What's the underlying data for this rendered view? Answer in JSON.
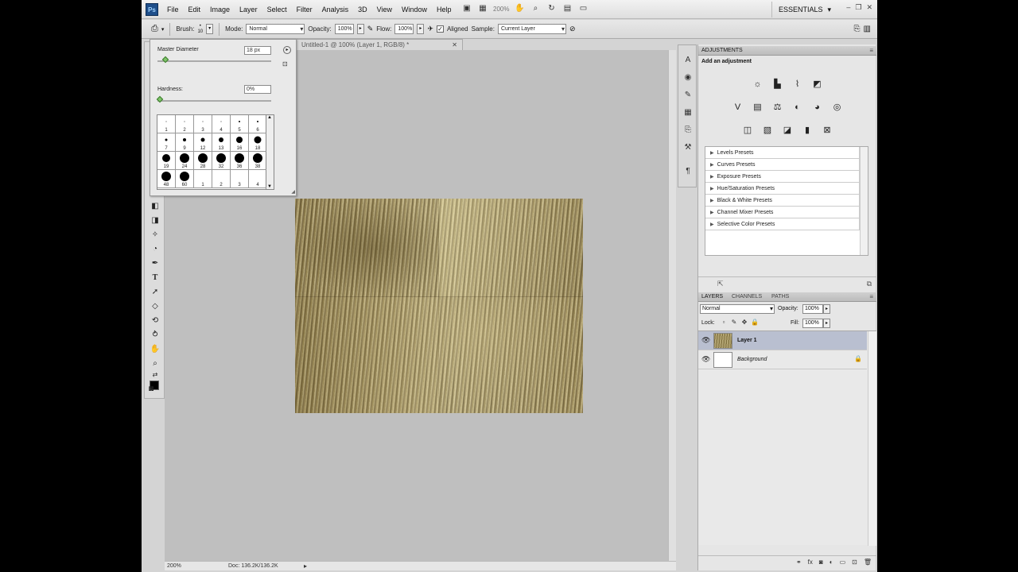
{
  "menubar": {
    "logo": "Ps",
    "items": [
      "File",
      "Edit",
      "Image",
      "Layer",
      "Select",
      "Filter",
      "Analysis",
      "3D",
      "View",
      "Window",
      "Help"
    ],
    "zoom": "200%",
    "workspace": "ESSENTIALS"
  },
  "options": {
    "brush_label": "Brush:",
    "brush_size": "10",
    "mode_label": "Mode:",
    "mode_value": "Normal",
    "opacity_label": "Opacity:",
    "opacity_value": "100%",
    "flow_label": "Flow:",
    "flow_value": "100%",
    "aligned_label": "Aligned",
    "sample_label": "Sample:",
    "sample_value": "Current Layer"
  },
  "brush_popup": {
    "master_diameter_label": "Master Diameter",
    "master_diameter_value": "18 px",
    "hardness_label": "Hardness:",
    "hardness_value": "0%",
    "presets": [
      {
        "label": "1",
        "dot": 1
      },
      {
        "label": "2",
        "dot": 1
      },
      {
        "label": "3",
        "dot": 1
      },
      {
        "label": "4",
        "dot": 1
      },
      {
        "label": "5",
        "dot": 2
      },
      {
        "label": "6",
        "dot": 2
      },
      {
        "label": "7",
        "dot": 3
      },
      {
        "label": "9",
        "dot": 4
      },
      {
        "label": "12",
        "dot": 5
      },
      {
        "label": "13",
        "dot": 6
      },
      {
        "label": "16",
        "dot": 8
      },
      {
        "label": "18",
        "dot": 9
      },
      {
        "label": "19",
        "dot": 10
      },
      {
        "label": "24",
        "dot": 12
      },
      {
        "label": "28",
        "dot": 12
      },
      {
        "label": "32",
        "dot": 12
      },
      {
        "label": "36",
        "dot": 12
      },
      {
        "label": "38",
        "dot": 12
      },
      {
        "label": "48",
        "dot": 12
      },
      {
        "label": "60",
        "dot": 12
      },
      {
        "label": "1",
        "dot": 0
      },
      {
        "label": "2",
        "dot": 0
      },
      {
        "label": "3",
        "dot": 0
      },
      {
        "label": "4",
        "dot": 0
      }
    ]
  },
  "document": {
    "tab_title": "Untitled-1 @ 100% (Layer 1, RGB/8) *",
    "status_zoom": "200%",
    "status_doc": "Doc: 136.2K/136.2K"
  },
  "adjustments": {
    "tab": "ADJUSTMENTS",
    "subtitle": "Add an adjustment",
    "presets": [
      "Levels Presets",
      "Curves Presets",
      "Exposure Presets",
      "Hue/Saturation Presets",
      "Black & White Presets",
      "Channel Mixer Presets",
      "Selective Color Presets"
    ]
  },
  "layers_panel": {
    "tabs": [
      "LAYERS",
      "CHANNELS",
      "PATHS"
    ],
    "blend_mode": "Normal",
    "opacity_label": "Opacity:",
    "opacity_value": "100%",
    "lock_label": "Lock:",
    "fill_label": "Fill:",
    "fill_value": "100%",
    "layers": [
      {
        "name": "Layer 1",
        "selected": true
      },
      {
        "name": "Background",
        "selected": false
      }
    ]
  },
  "colors": {
    "canvas_bg": "#bfbfbf",
    "selected_layer": "#b9bfd0",
    "brush_slider_thumb": "#7fc46a"
  }
}
